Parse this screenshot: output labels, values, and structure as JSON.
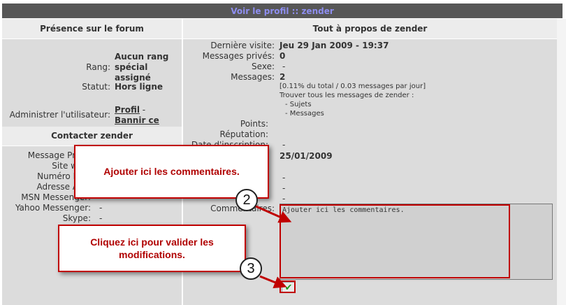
{
  "title": "Voir le profil :: zender",
  "left": {
    "presence_header": "Présence sur le forum",
    "rank_label": "Rang:",
    "rank_value": "Aucun rang spécial assigné",
    "status_label": "Statut:",
    "status_value": "Hors ligne",
    "admin_label": "Administrer l'utilisateur:",
    "profile_link": "Profil",
    "dash": "-",
    "ban_link": "Bannir ce membre",
    "contact_header": "Contacter zender",
    "contact_rows": [
      {
        "label": "Message Privé:",
        "value": ""
      },
      {
        "label": "Site web:",
        "value": ""
      },
      {
        "label": "Numéro ICQ:",
        "value": ""
      },
      {
        "label": "Adresse AIM:",
        "value": ""
      },
      {
        "label": "MSN Messenger:",
        "value": ""
      },
      {
        "label": "Yahoo Messenger:",
        "value": "-"
      },
      {
        "label": "Skype:",
        "value": "-"
      }
    ]
  },
  "right": {
    "header": "Tout à propos de zender",
    "last_visit_label": "Dernière visite:",
    "last_visit_value": "Jeu 29 Jan 2009 - 19:37",
    "pm_label": "Messages privés:",
    "pm_value": "0",
    "sex_label": "Sexe:",
    "sex_value": "-",
    "messages_label": "Messages:",
    "messages_value": "2",
    "messages_stats": "[0.11% du total / 0.03 messages par jour]",
    "find_all": "Trouver tous les messages de zender :",
    "find_topics": "- Sujets",
    "find_messages": "- Messages",
    "points_label": "Points:",
    "reputation_label": "Réputation:",
    "date_label": "Date d'inscription:",
    "date_value": "25/01/2009",
    "extra_values": [
      "-",
      "-",
      "-"
    ],
    "comments_label": "Commentaires:",
    "comments_value": "Ajouter ici les commentaires."
  },
  "callouts": {
    "c1_text": "Ajouter ici les commentaires.",
    "c2_text": "Cliquez ici pour valider les modifications.",
    "n2": "2",
    "n3": "3"
  },
  "colors": {
    "titlebar": "#575757",
    "title_text": "#8e8ef0",
    "panel": "#dcdcdc",
    "accent": "#c00000"
  }
}
